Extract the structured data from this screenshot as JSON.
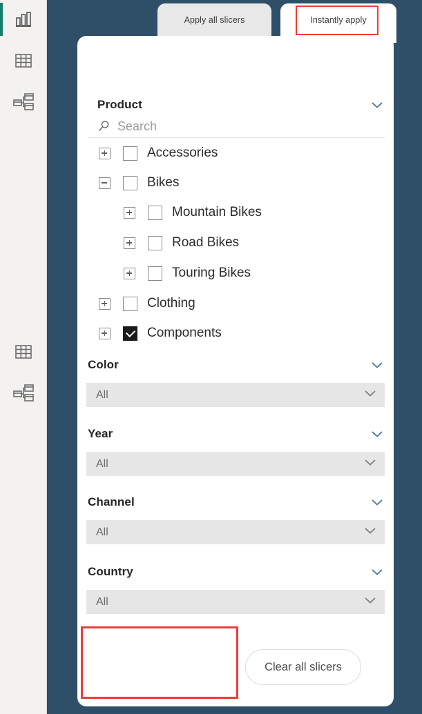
{
  "theme": {
    "background": "#2f4e68",
    "panel_bg": "#ffffff",
    "rail_bg": "#f3f2f1",
    "accent_selected": "#16806a",
    "highlight_red": "#ef3b36",
    "dropdown_bg": "#e6e6e6"
  },
  "rail": {
    "items": [
      {
        "name": "report-view-icon",
        "label": "Report",
        "selected": true
      },
      {
        "name": "data-view-icon",
        "label": "Data",
        "selected": false
      },
      {
        "name": "model-view-icon",
        "label": "Model",
        "selected": false
      },
      {
        "name": "data-view-icon-2",
        "label": "Data",
        "selected": false
      },
      {
        "name": "model-view-icon-2",
        "label": "Model",
        "selected": false
      }
    ]
  },
  "tabs": [
    {
      "label": "Apply all slicers",
      "active": false,
      "highlighted": false
    },
    {
      "label": "Instantly apply",
      "active": true,
      "highlighted": true
    }
  ],
  "product_slicer": {
    "title": "Product",
    "search_placeholder": "Search",
    "search_value": "",
    "items": [
      {
        "label": "Accessories",
        "level": 0,
        "expander": "plus",
        "checked": false
      },
      {
        "label": "Bikes",
        "level": 0,
        "expander": "minus",
        "checked": false
      },
      {
        "label": "Mountain Bikes",
        "level": 1,
        "expander": "plus",
        "checked": false
      },
      {
        "label": "Road Bikes",
        "level": 1,
        "expander": "plus",
        "checked": false
      },
      {
        "label": "Touring Bikes",
        "level": 1,
        "expander": "plus",
        "checked": false
      },
      {
        "label": "Clothing",
        "level": 0,
        "expander": "plus",
        "checked": false
      },
      {
        "label": "Components",
        "level": 0,
        "expander": "plus",
        "checked": true
      }
    ]
  },
  "dropdown_slicers": [
    {
      "title": "Color",
      "value": "All"
    },
    {
      "title": "Year",
      "value": "All"
    },
    {
      "title": "Channel",
      "value": "All"
    },
    {
      "title": "Country",
      "value": "All"
    }
  ],
  "footer": {
    "clear_button_label": "Clear all slicers",
    "empty_highlight_region": ""
  }
}
